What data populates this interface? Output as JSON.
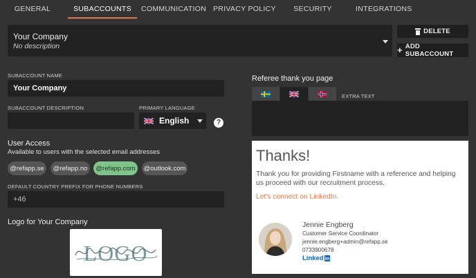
{
  "tabs": [
    {
      "label": "GENERAL"
    },
    {
      "label": "SUBACCOUNTS"
    },
    {
      "label": "COMMUNICATION"
    },
    {
      "label": "PRIVACY POLICY"
    },
    {
      "label": "SECURITY"
    },
    {
      "label": "INTEGRATIONS"
    }
  ],
  "active_tab": "SUBACCOUNTS",
  "subaccount_select": {
    "name": "Your Company",
    "description": "No description"
  },
  "actions": {
    "delete_label": "DELETE",
    "add_label": "ADD SUBACCOUNT"
  },
  "form": {
    "name_label": "SUBACCOUNT NAME",
    "name_value": "Your Company",
    "description_label": "SUBACCOUNT DESCRIPTION",
    "description_value": "",
    "language_label": "PRIMARY LANGUAGE",
    "language_value": "English",
    "help_glyph": "?"
  },
  "user_access": {
    "title": "User Access",
    "subtitle": "Available to users with the selected email addresses",
    "domains": [
      {
        "label": "@refapp.se",
        "selected": false
      },
      {
        "label": "@refapp.no",
        "selected": false
      },
      {
        "label": "@refapp.com",
        "selected": true
      },
      {
        "label": "@outlook.com",
        "selected": false
      }
    ]
  },
  "phone": {
    "label": "DEFAULT COUNTRY PREFIX FOR PHONE NUMBERS",
    "value": "+46"
  },
  "logo": {
    "title": "Logo for Your Company"
  },
  "referee": {
    "title": "Referee thank you page",
    "flags": [
      "flag-sweden-icon",
      "flag-uk-icon",
      "flag-norway-icon"
    ],
    "selected_flag": "flag-uk-icon",
    "extra_text_label": "EXTRA TEXT",
    "extra_text_value": ""
  },
  "preview": {
    "title": "Thanks!",
    "body": "Thank you for providing Firstname with a reference and helping us proceed with our recruitment process.",
    "link": "Let's connect on LinkedIn.",
    "contact": {
      "name": "Jennie Engberg",
      "role": "Customer Service Coordinator",
      "email": "jennie.engberg+admin@refapp.se",
      "phone": "0733900678",
      "linkedin_word": "Linked",
      "linkedin_in": "in"
    }
  },
  "colors": {
    "accent": "#e07a48",
    "chip_selected": "#7fc48a",
    "background": "#333333",
    "field": "#222222"
  }
}
